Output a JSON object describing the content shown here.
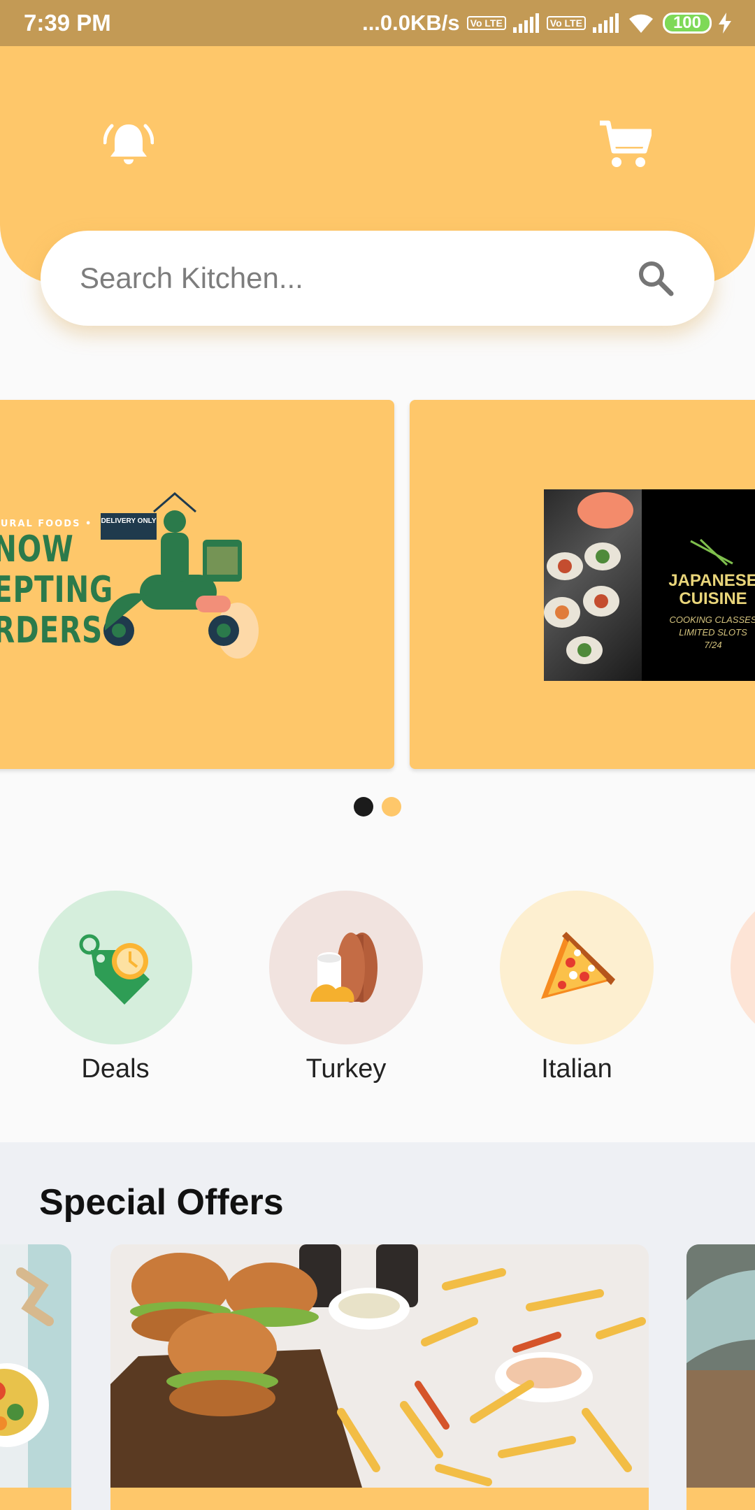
{
  "status_bar": {
    "time": "7:39 PM",
    "network": "...0.0KB/s",
    "volte_1": "Vo LTE",
    "volte_2": "Vo LTE",
    "battery": "100"
  },
  "header": {
    "notification_icon": "bell-icon",
    "cart_icon": "cart-icon"
  },
  "search": {
    "placeholder": "Search Kitchen...",
    "icon": "search-icon"
  },
  "banners": [
    {
      "small_text": "TURAL FOODS •",
      "lines": [
        "NOW",
        "EPTING",
        "RDERS"
      ],
      "sign_text": "DELIVERY ONLY"
    },
    {
      "title": "JAPANESE CUISINE",
      "subtitle": "COOKING CLASSES LIMITED SLOTS",
      "date": "7/24"
    }
  ],
  "carousel": {
    "active_color": "#1b1b1b",
    "inactive_color": "#fec76a"
  },
  "categories": [
    {
      "label": "Deals",
      "icon": "price-tag-clock-icon",
      "bg": "#d5eedc"
    },
    {
      "label": "Turkey",
      "icon": "bread-icon",
      "bg": "#f1e3df"
    },
    {
      "label": "Italian",
      "icon": "pizza-slice-icon",
      "bg": "#fdefd0"
    },
    {
      "label": "",
      "icon": "partial-category-icon",
      "bg": "#fde4d6"
    }
  ],
  "special_offers": {
    "title": "Special Offers"
  },
  "colors": {
    "accent": "#fec76a",
    "status_bar": "#c39a55"
  }
}
